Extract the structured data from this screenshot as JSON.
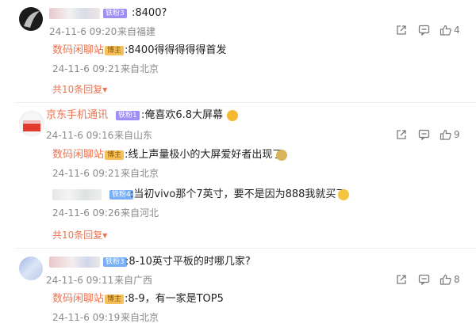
{
  "comments": [
    {
      "username": "",
      "level_badge": "铁粉3",
      "text": ":8400?",
      "time": "24-11-6 09:20",
      "location": "来自福建",
      "likes": "4",
      "replies": [
        {
          "username": "数码闲聊站",
          "badge": "博主",
          "text": ":8400得得得得得首发",
          "time": "24-11-6 09:21",
          "location": "来自北京"
        }
      ],
      "more_label": "共10条回复"
    },
    {
      "username": "京东手机通讯",
      "level_badge": "铁粉1",
      "text": ":俺喜欢6.8大屏幕",
      "time": "24-11-6 09:16",
      "location": "来自山东",
      "likes": "9",
      "replies": [
        {
          "username": "数码闲聊站",
          "badge": "博主",
          "text": ":线上声量极小的大屏爱好者出现了",
          "time": "24-11-6 09:21",
          "location": "来自北京"
        },
        {
          "username": "",
          "badge": "铁粉4",
          "text": ":当初vivo那个7英寸，要不是因为888我就买了",
          "time": "24-11-6 09:26",
          "location": "来自河北"
        }
      ],
      "more_label": "共10条回复"
    },
    {
      "username": "",
      "level_badge": "铁粉3",
      "text": ":8-10英寸平板的时哪几家?",
      "time": "24-11-6 09:11",
      "location": "来自广西",
      "likes": "8",
      "replies": [
        {
          "username": "数码闲聊站",
          "badge": "博主",
          "text": ":8-9，有一家是TOP5",
          "time": "24-11-6 09:19",
          "location": "来自北京"
        }
      ]
    }
  ],
  "icons": {
    "share": "share-icon",
    "comment": "comment-icon",
    "like": "thumbs-up-icon",
    "more_arrow": "chevron-down-icon"
  },
  "colors": {
    "accent": "#eb7350",
    "meta": "#8a8a8a",
    "badge_level": "#9d8ff4",
    "badge_author": "#f6c05b"
  }
}
